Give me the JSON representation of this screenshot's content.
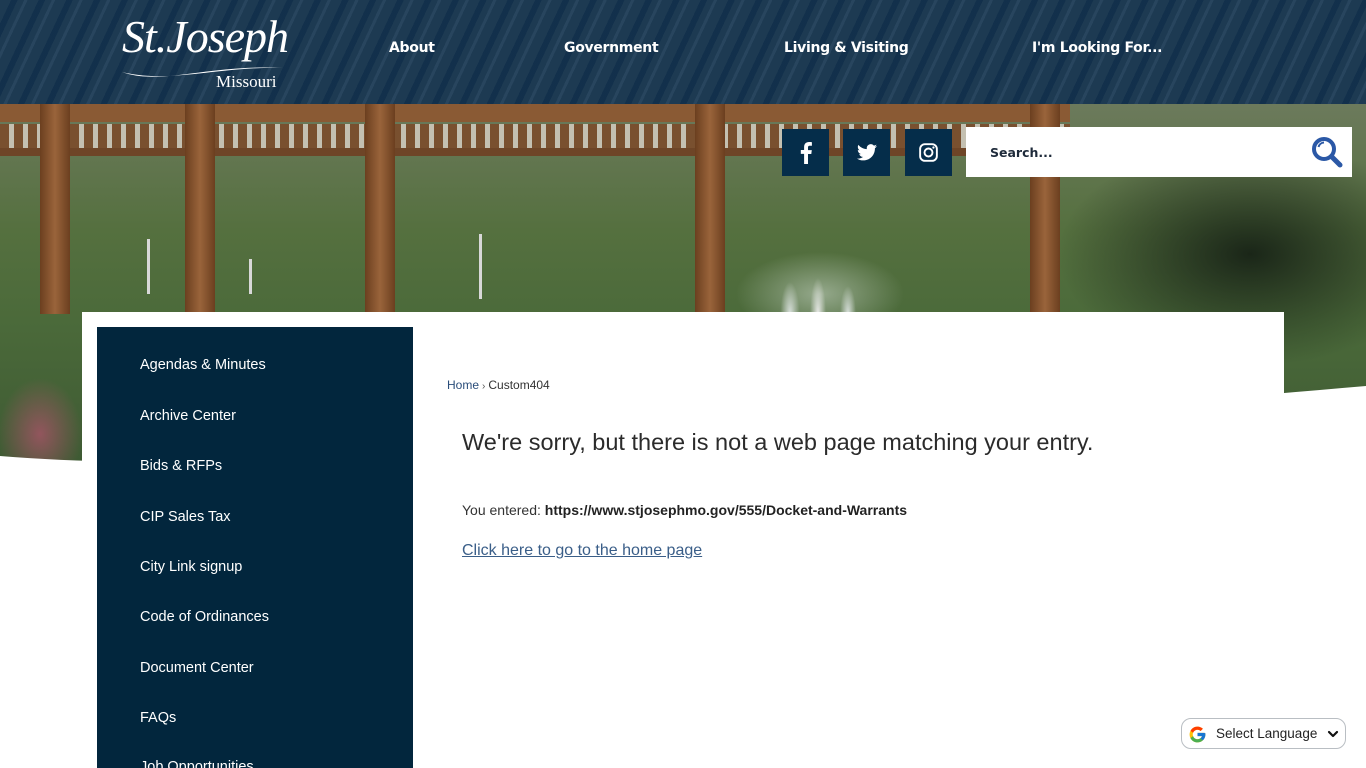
{
  "site": {
    "logo_main": "St.Joseph",
    "logo_sub": "Missouri"
  },
  "nav": {
    "items": [
      {
        "label": "About"
      },
      {
        "label": "Government"
      },
      {
        "label": "Living & Visiting"
      },
      {
        "label": "I'm Looking For..."
      }
    ]
  },
  "social": {
    "items": [
      {
        "name": "facebook",
        "icon": "facebook-icon",
        "glyph": "f"
      },
      {
        "name": "twitter",
        "icon": "twitter-icon"
      },
      {
        "name": "instagram",
        "icon": "instagram-icon"
      }
    ],
    "bg_color": "#052d4a"
  },
  "search": {
    "placeholder": "Search...",
    "value": "",
    "icon": "search-icon",
    "icon_color": "#2b58a6"
  },
  "sidebar": {
    "items": [
      {
        "label": "Agendas & Minutes"
      },
      {
        "label": "Archive Center"
      },
      {
        "label": "Bids & RFPs"
      },
      {
        "label": "CIP Sales Tax"
      },
      {
        "label": "City Link signup"
      },
      {
        "label": "Code of Ordinances"
      },
      {
        "label": "Document Center"
      },
      {
        "label": "FAQs"
      },
      {
        "label": "Job Opportunities"
      }
    ],
    "bg_color": "#02263d"
  },
  "breadcrumb": {
    "home": "Home",
    "separator": "›",
    "current": "Custom404"
  },
  "main": {
    "title": "We're sorry, but there is not a web page matching your entry.",
    "entered_label": "You entered: ",
    "entered_url": "https://www.stjosephmo.gov/555/Docket-and-Warrants",
    "home_link": "Click here to go to the home page"
  },
  "language": {
    "label": "Select Language",
    "icon": "google-g-icon"
  },
  "colors": {
    "header": "#1d3a52",
    "link": "#3a5e88",
    "breadcrumb_link": "#2a4d7a"
  }
}
